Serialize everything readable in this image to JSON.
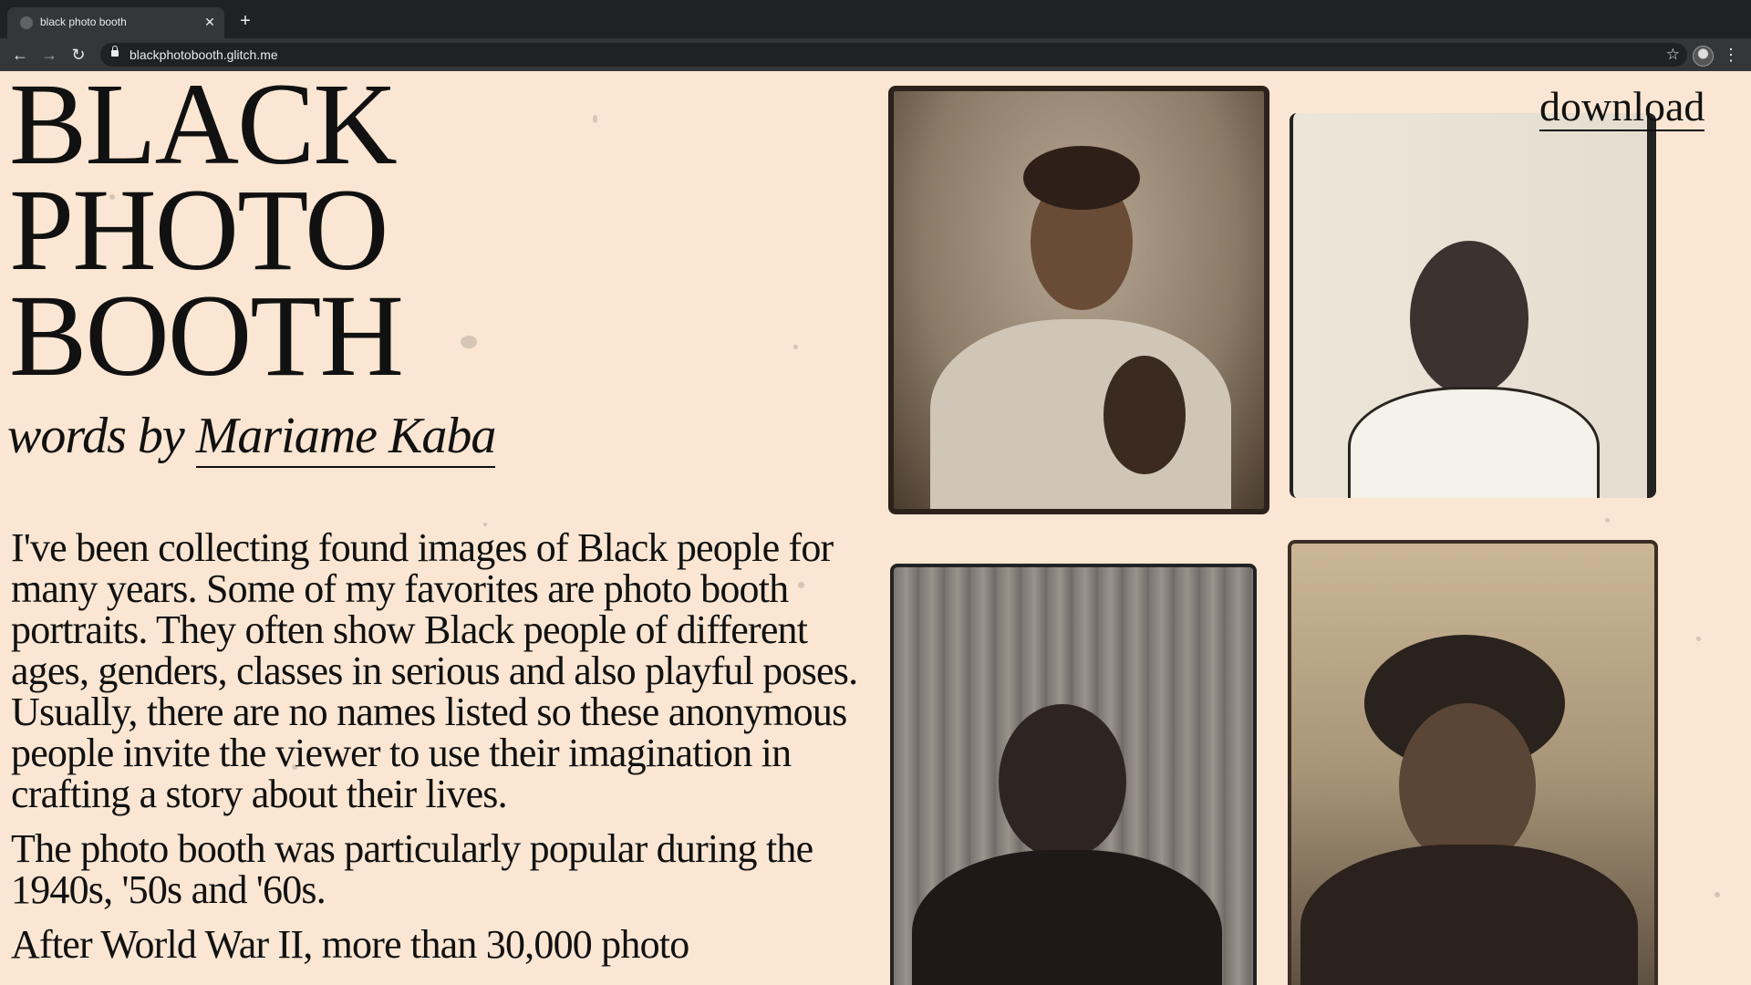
{
  "browser": {
    "tab_title": "black photo booth",
    "tab_close_icon": "close-icon",
    "new_tab_icon": "plus-icon",
    "url": "blackphotobooth.glitch.me",
    "back_glyph": "←",
    "forward_glyph": "→",
    "reload_glyph": "↻",
    "star_glyph": "☆",
    "menu_glyph": "⋮",
    "close_glyph": "✕",
    "plus_glyph": "+"
  },
  "page": {
    "title_lines": [
      "BLACK",
      "PHOTO",
      "BOOTH"
    ],
    "byline_prefix": "words by ",
    "byline_author": "Mariame Kaba",
    "download_label": "download",
    "paragraphs": [
      "I've been collecting found images of Black people for many years. Some of my favorites are photo booth portraits. They often show Black people of different ages, genders, classes in serious and also playful poses. Usually, there are no names listed so these anonymous people invite the viewer to use their imagination in crafting a story about their lives.",
      "The photo booth was particularly popular during the 1940s, '50s and '60s.",
      "After World War II, more than 30,000 photo"
    ],
    "background_color": "#fae6d2"
  }
}
